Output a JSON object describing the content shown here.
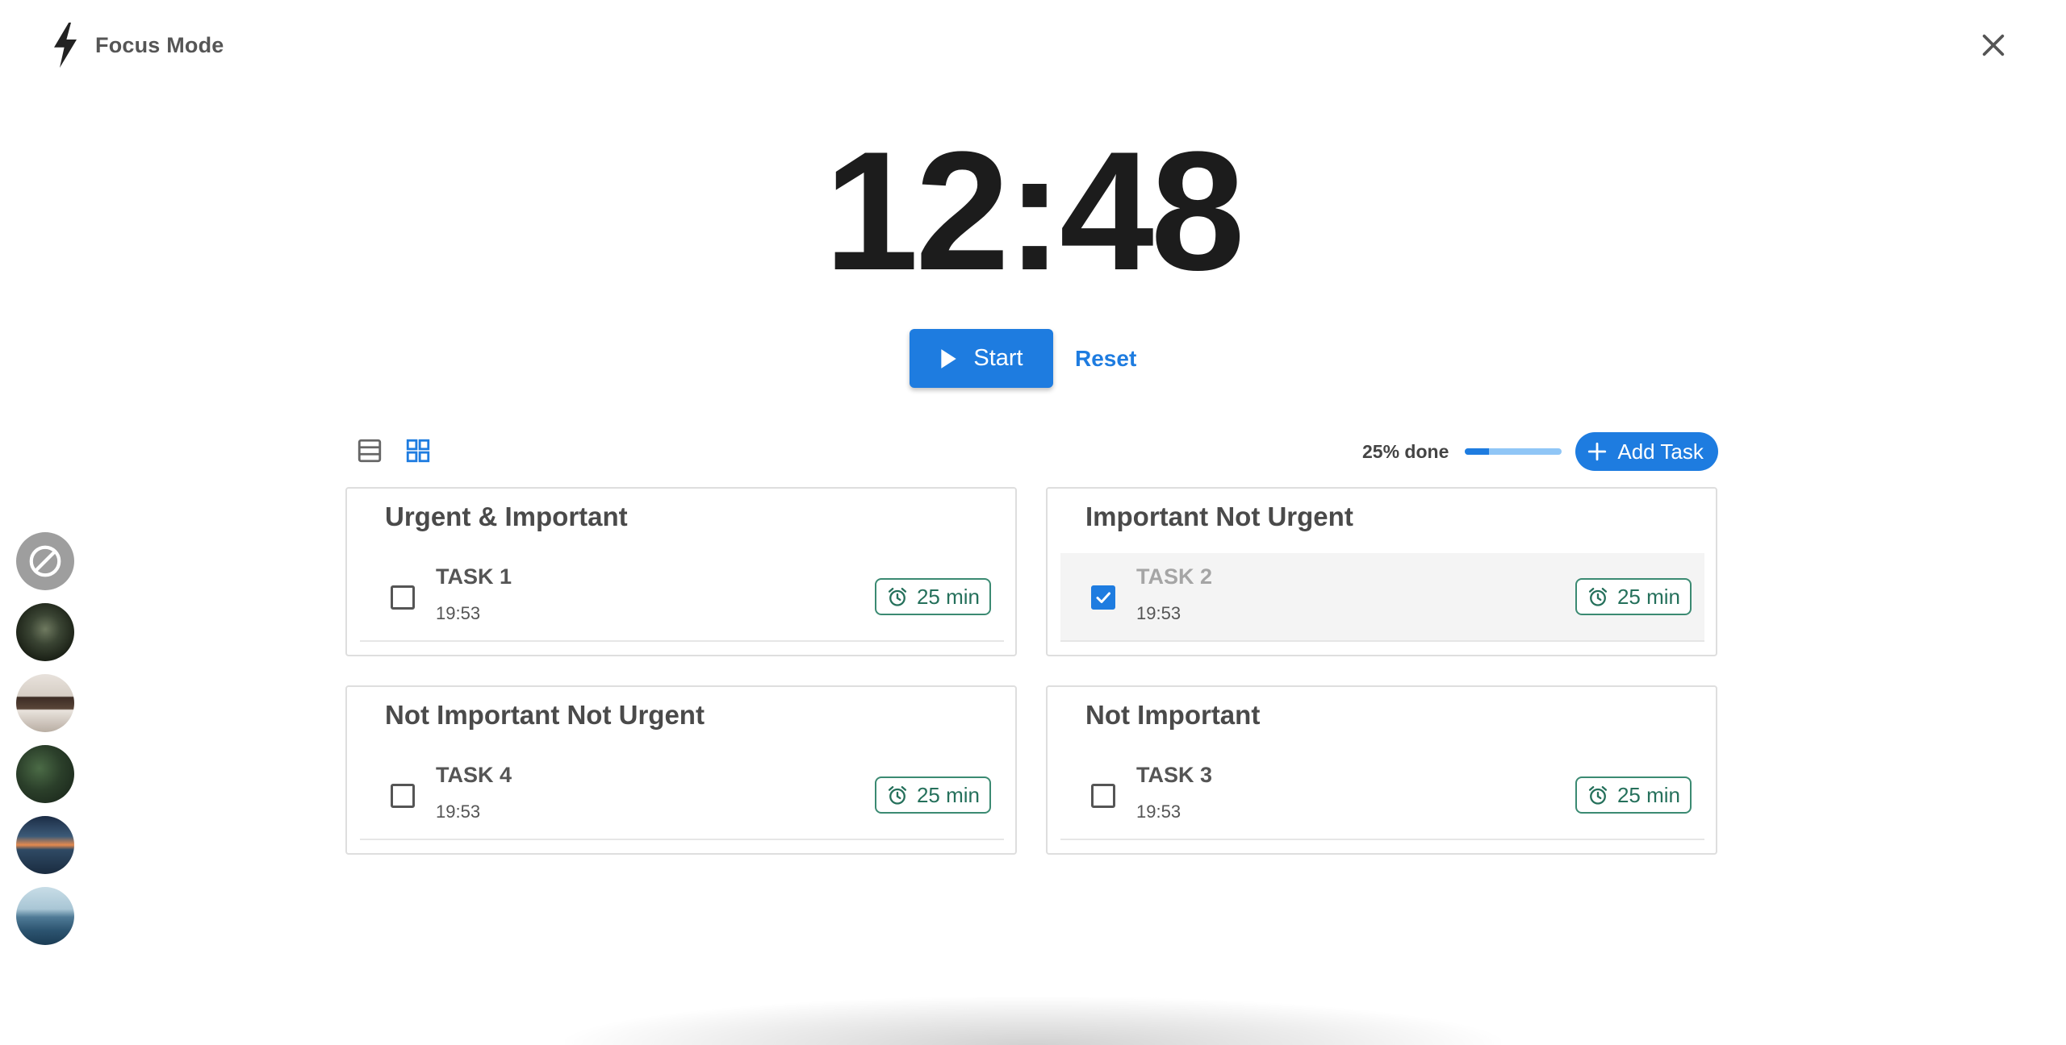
{
  "app": {
    "title": "Focus Mode"
  },
  "timer": {
    "display": "12:48"
  },
  "controls": {
    "start_label": "Start",
    "reset_label": "Reset"
  },
  "progress": {
    "label": "25% done",
    "percent": 25
  },
  "toolbar": {
    "add_task_label": "Add Task",
    "active_view": "grid"
  },
  "quadrants": [
    {
      "title": "Urgent & Important",
      "tasks": [
        {
          "name": "TASK 1",
          "time": "19:53",
          "duration": "25 min",
          "done": false
        }
      ]
    },
    {
      "title": "Important Not Urgent",
      "tasks": [
        {
          "name": "TASK 2",
          "time": "19:53",
          "duration": "25 min",
          "done": true
        }
      ]
    },
    {
      "title": "Not Important Not Urgent",
      "tasks": [
        {
          "name": "TASK 4",
          "time": "19:53",
          "duration": "25 min",
          "done": false
        }
      ]
    },
    {
      "title": "Not Important",
      "tasks": [
        {
          "name": "TASK 3",
          "time": "19:53",
          "duration": "25 min",
          "done": false
        }
      ]
    }
  ],
  "scenes": [
    "none-icon",
    "forest-scene",
    "room-scene",
    "jungle-scene",
    "sunset-scene",
    "sea-scene"
  ],
  "colors": {
    "accent": "#1e7ce0",
    "accent_light": "#90c6f6",
    "duration_green": "#25705b",
    "text_dark": "#1c1c1c"
  }
}
